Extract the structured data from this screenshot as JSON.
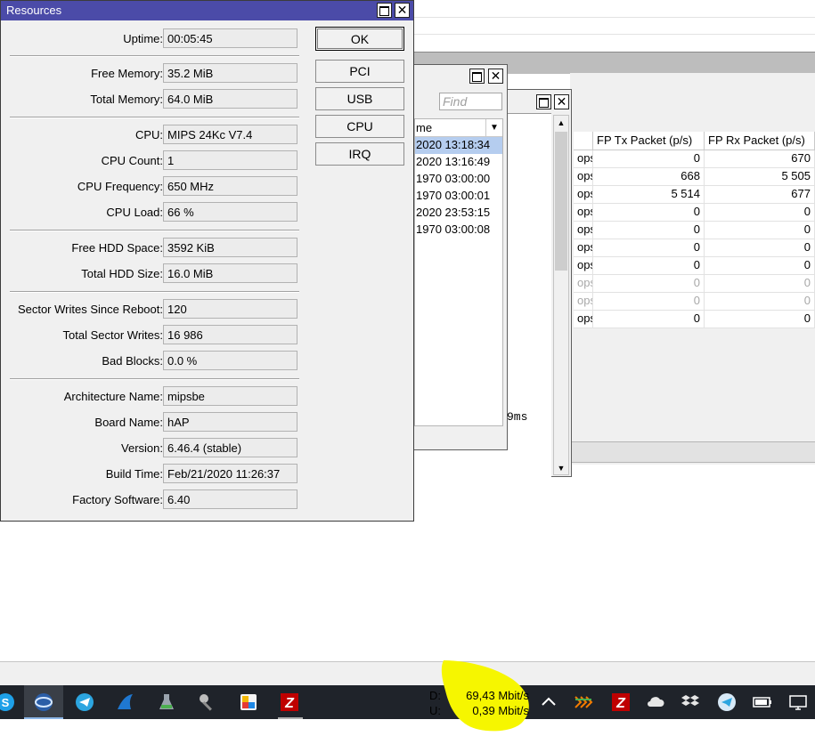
{
  "resources_window": {
    "title": "Resources",
    "fields": [
      {
        "label": "Uptime:",
        "value": "00:05:45"
      },
      {
        "label": "Free Memory:",
        "value": "35.2 MiB"
      },
      {
        "label": "Total Memory:",
        "value": "64.0 MiB"
      },
      {
        "label": "CPU:",
        "value": "MIPS 24Kc V7.4"
      },
      {
        "label": "CPU Count:",
        "value": "1"
      },
      {
        "label": "CPU Frequency:",
        "value": "650 MHz"
      },
      {
        "label": "CPU Load:",
        "value": "66 %"
      },
      {
        "label": "Free HDD Space:",
        "value": "3592 KiB"
      },
      {
        "label": "Total HDD Size:",
        "value": "16.0 MiB"
      },
      {
        "label": "Sector Writes Since Reboot:",
        "value": "120"
      },
      {
        "label": "Total Sector Writes:",
        "value": "16 986"
      },
      {
        "label": "Bad Blocks:",
        "value": "0.0 %"
      },
      {
        "label": "Architecture Name:",
        "value": "mipsbe"
      },
      {
        "label": "Board Name:",
        "value": "hAP"
      },
      {
        "label": "Version:",
        "value": "6.46.4 (stable)"
      },
      {
        "label": "Build Time:",
        "value": "Feb/21/2020 11:26:37"
      },
      {
        "label": "Factory Software:",
        "value": "6.40"
      }
    ],
    "buttons": {
      "ok": "OK",
      "pci": "PCI",
      "usb": "USB",
      "cpu": "CPU",
      "irq": "IRQ"
    }
  },
  "history_window": {
    "find_placeholder": "Find",
    "column_header": "me",
    "rows": [
      "2020 13:18:34",
      "2020 13:16:49",
      "1970 03:00:00",
      "1970 03:00:01",
      "2020 23:53:15",
      "1970 03:00:08"
    ]
  },
  "log_window": {
    "text_fragment": "9ms"
  },
  "traffic_table": {
    "columns": [
      "",
      "FP Tx Packet (p/s)",
      "FP Rx Packet (p/s)"
    ],
    "rows": [
      {
        "rate": "ops",
        "tx": "0",
        "rx": "670",
        "dim": false
      },
      {
        "rate": "ops",
        "tx": "668",
        "rx": "5 505",
        "dim": false
      },
      {
        "rate": "ops",
        "tx": "5 514",
        "rx": "677",
        "dim": false
      },
      {
        "rate": "ops",
        "tx": "0",
        "rx": "0",
        "dim": false
      },
      {
        "rate": "ops",
        "tx": "0",
        "rx": "0",
        "dim": false
      },
      {
        "rate": "ops",
        "tx": "0",
        "rx": "0",
        "dim": false
      },
      {
        "rate": "ops",
        "tx": "0",
        "rx": "0",
        "dim": false
      },
      {
        "rate": "ops",
        "tx": "0",
        "rx": "0",
        "dim": true
      },
      {
        "rate": "ops",
        "tx": "0",
        "rx": "0",
        "dim": true
      },
      {
        "rate": "ops",
        "tx": "0",
        "rx": "0",
        "dim": false
      }
    ]
  },
  "taskbar": {
    "apps": [
      "skype-icon",
      "browser-icon",
      "telegram-icon",
      "shark-icon",
      "flask-icon",
      "tools-icon",
      "paint-icon",
      "filezilla-icon"
    ],
    "net_meter": {
      "down_label": "D:",
      "down_value": "69,43 Mbit/s",
      "up_label": "U:",
      "up_value": "0,39 Mbit/s"
    },
    "tray": [
      "chevron-up-icon",
      "tray-app-icon",
      "filezilla-tray-icon",
      "cloud-icon",
      "dropbox-icon",
      "telegram-tray-icon",
      "battery-icon",
      "display-icon"
    ]
  },
  "colors": {
    "titlebar": "#4b4ba8",
    "selection": "#b5cdef",
    "taskbar": "#1f232a",
    "highlight": "#f6f600"
  }
}
